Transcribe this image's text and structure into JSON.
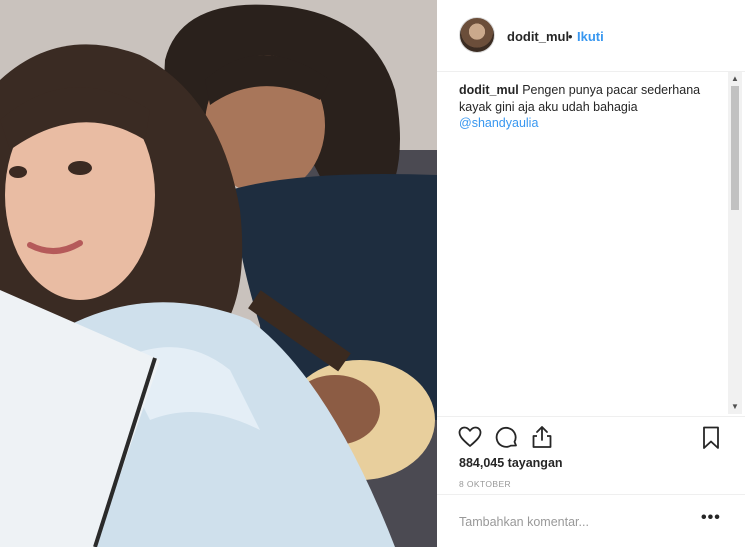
{
  "post": {
    "username": "dodit_mul",
    "separator": "•",
    "follow_label": "Ikuti",
    "caption": {
      "username": "dodit_mul",
      "text": " Pengen punya pacar sederhana kayak gini aja aku udah bahagia",
      "mention": "@shandyaulia"
    },
    "views": "884,045 tayangan",
    "date": "8 OKTOBER",
    "comment_placeholder": "Tambahkan komentar...",
    "more_label": "•••"
  },
  "icons": {
    "like": "heart-icon",
    "comment": "comment-bubble-icon",
    "share": "share-icon",
    "save": "bookmark-icon",
    "more": "more-options-icon"
  },
  "colors": {
    "accent": "#3897f0",
    "text": "#262626",
    "muted": "#999999",
    "divider": "#efefef"
  }
}
